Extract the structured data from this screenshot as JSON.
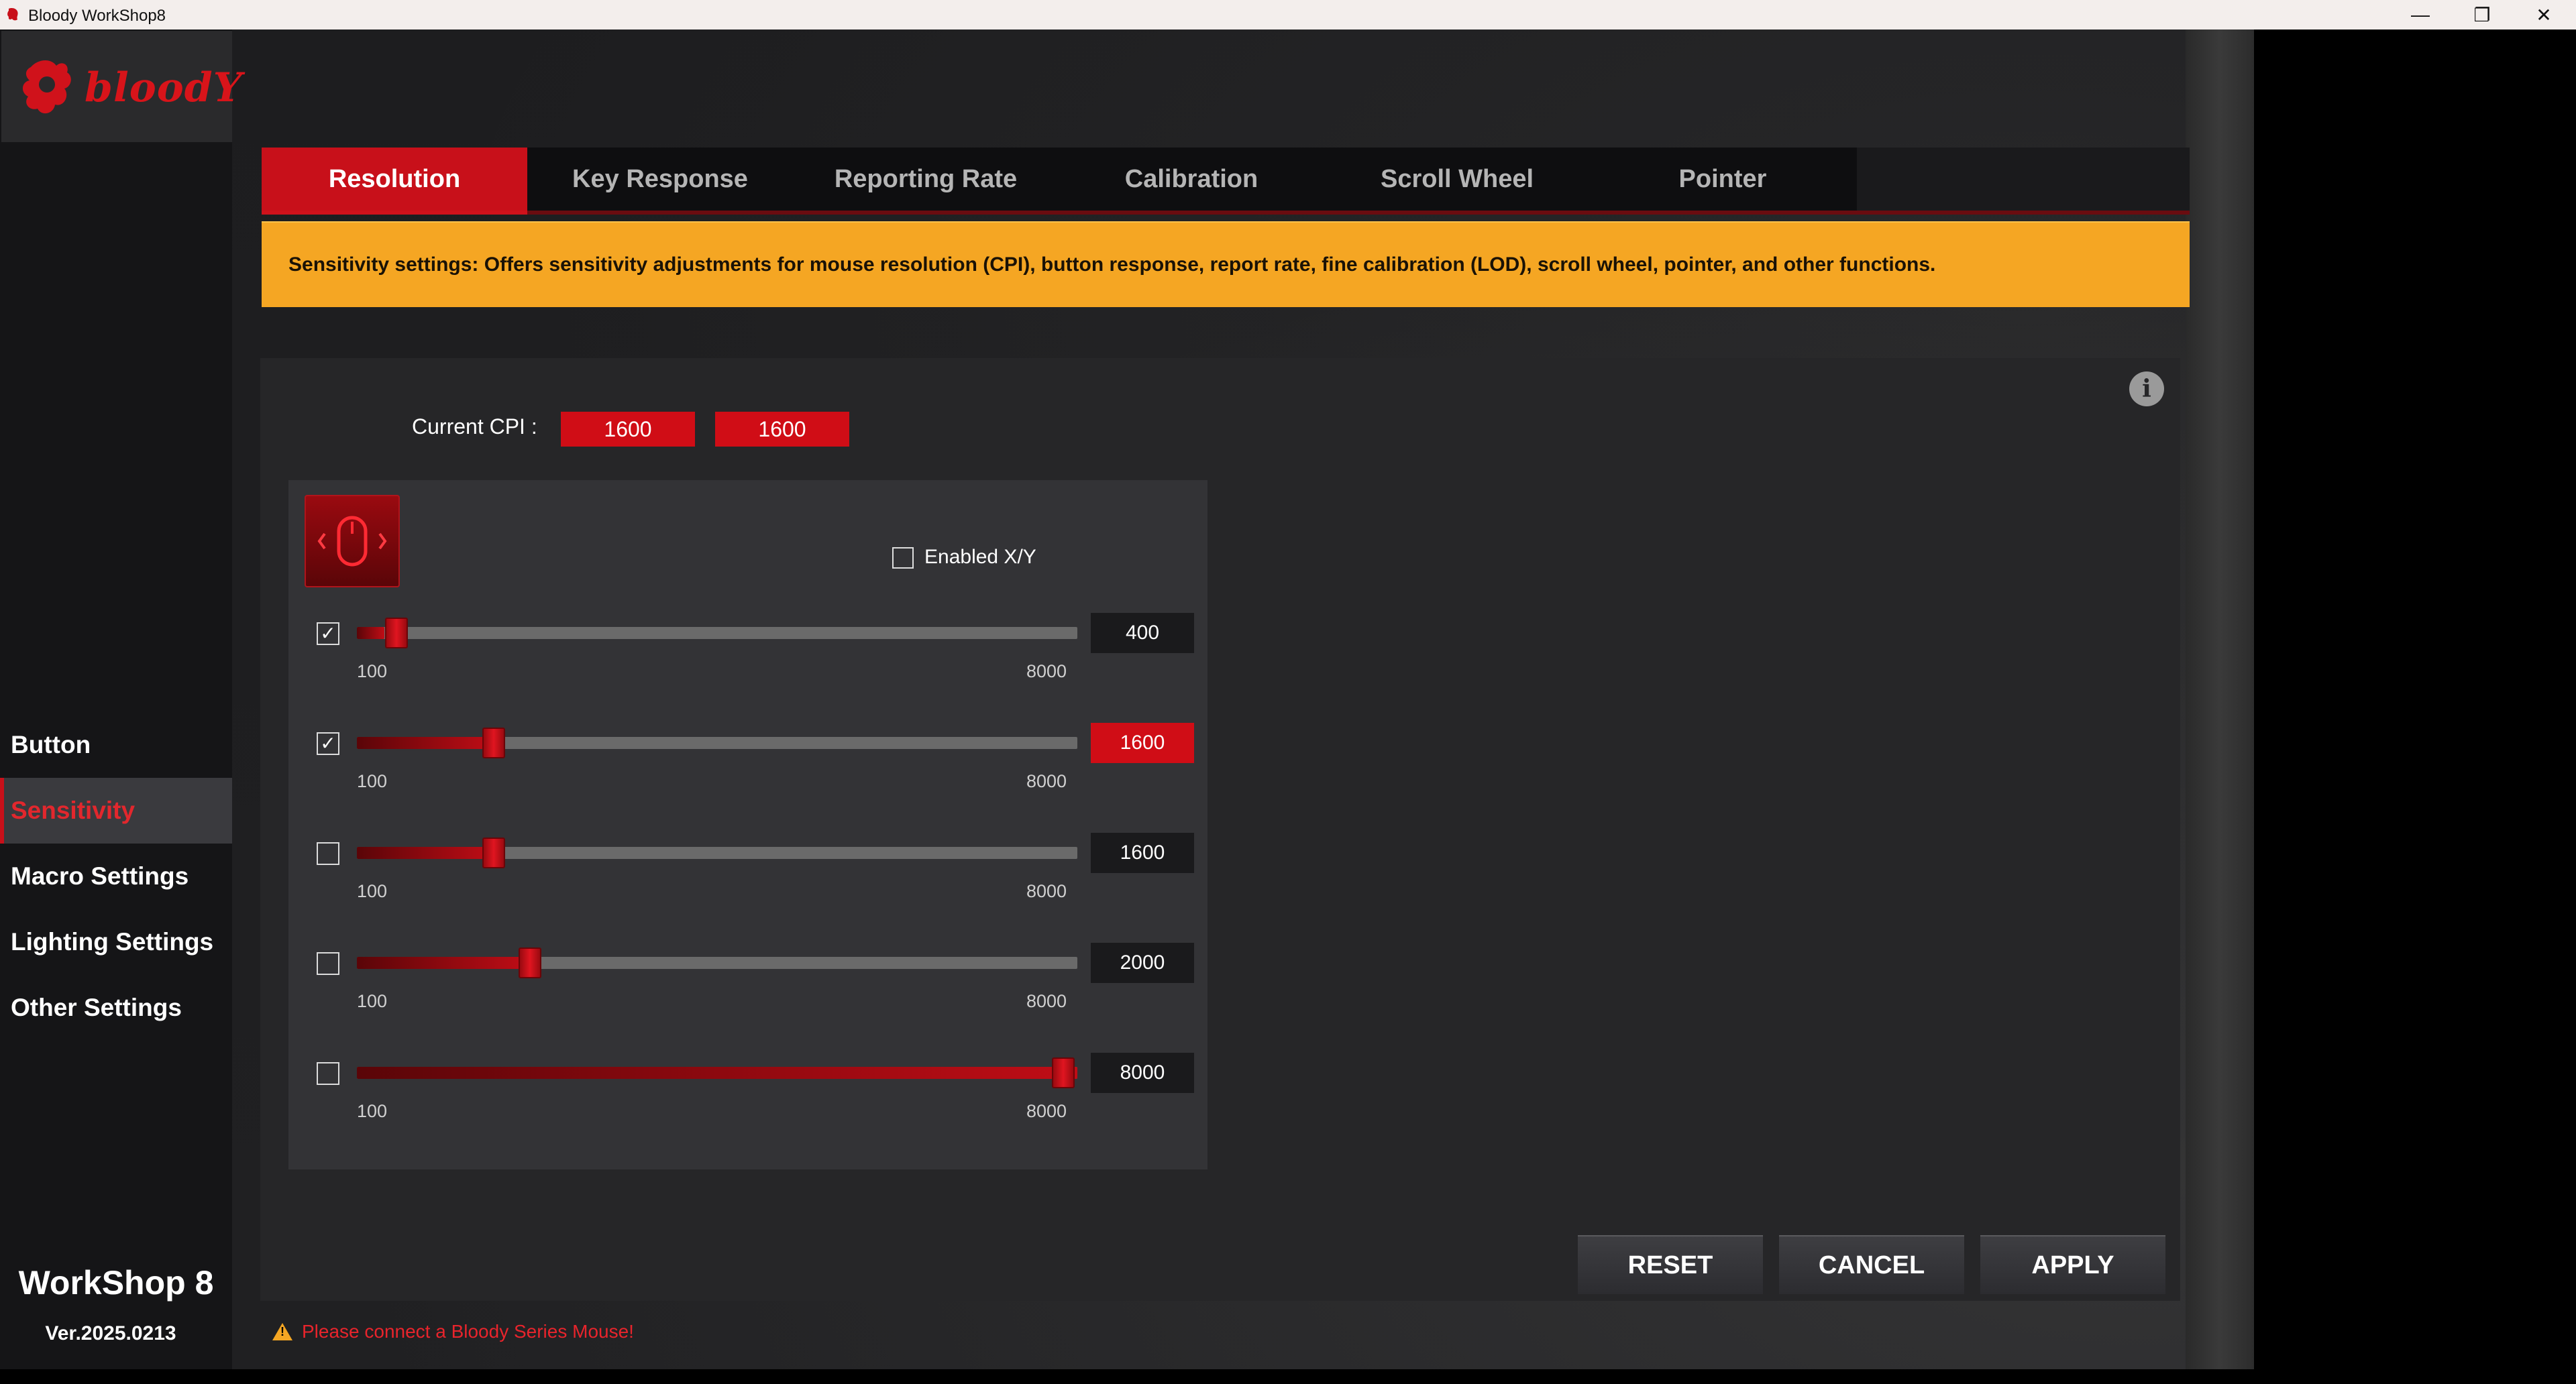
{
  "window": {
    "title": "Bloody WorkShop8",
    "controls": {
      "minimize": "—",
      "restore": "❐",
      "close": "✕"
    }
  },
  "sidebar": {
    "logo_text": "bloodY",
    "items": [
      {
        "label": "Button",
        "active": false
      },
      {
        "label": "Sensitivity",
        "active": true
      },
      {
        "label": "Macro Settings",
        "active": false
      },
      {
        "label": "Lighting Settings",
        "active": false
      },
      {
        "label": "Other Settings",
        "active": false
      }
    ],
    "brand_title": "WorkShop 8",
    "version": "Ver.2025.0213"
  },
  "tabs": [
    {
      "label": "Resolution",
      "active": true
    },
    {
      "label": "Key Response",
      "active": false
    },
    {
      "label": "Reporting Rate",
      "active": false
    },
    {
      "label": "Calibration",
      "active": false
    },
    {
      "label": "Scroll Wheel",
      "active": false
    },
    {
      "label": "Pointer",
      "active": false
    }
  ],
  "banner_text": "Sensitivity settings: Offers sensitivity adjustments for mouse resolution (CPI), button response, report rate, fine calibration (LOD), scroll wheel, pointer, and other functions.",
  "cpi": {
    "label": "Current CPI :",
    "x": "1600",
    "y": "1600"
  },
  "xy": {
    "label": "Enabled X/Y",
    "checked": false
  },
  "sliders": {
    "min": 100,
    "max": 8000,
    "min_label": "100",
    "max_label": "8000",
    "rows": [
      {
        "value": "400",
        "checked": true,
        "active": false
      },
      {
        "value": "1600",
        "checked": true,
        "active": true
      },
      {
        "value": "1600",
        "checked": false,
        "active": false
      },
      {
        "value": "2000",
        "checked": false,
        "active": false
      },
      {
        "value": "8000",
        "checked": false,
        "active": false
      }
    ]
  },
  "buttons": {
    "reset": "RESET",
    "cancel": "CANCEL",
    "apply": "APPLY"
  },
  "status_text": "Please connect a Bloody Series Mouse!",
  "colors": {
    "accent": "#c8101a",
    "banner": "#f5a623",
    "status": "#e8242c"
  }
}
